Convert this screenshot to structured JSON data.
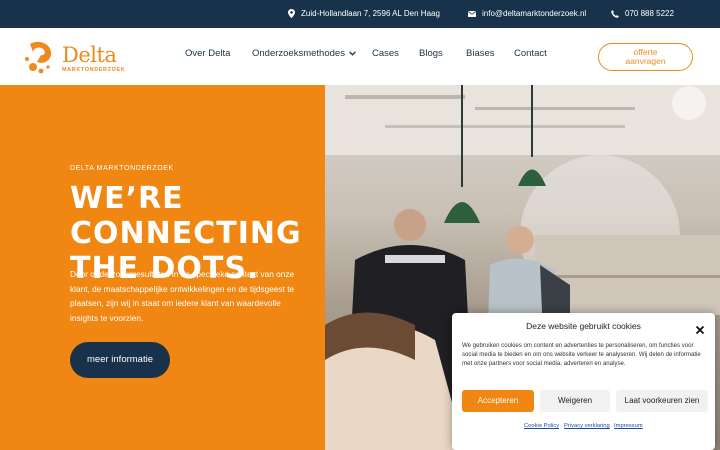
{
  "topbar": {
    "address": "Zuid-Hollandlaan 7, 2596 AL Den Haag",
    "email": "info@deltamarktonderzoek.nl",
    "phone": "070 888 5222"
  },
  "header": {
    "logo_word": "Delta",
    "logo_sub": "MARKTONDERZOEK",
    "nav": [
      "Over Delta",
      "Onderzoeksmethodes",
      "Cases",
      "Blogs",
      "Biases",
      "Contact"
    ],
    "cta_line1": "offerte",
    "cta_line2": "aanvragen"
  },
  "hero": {
    "eyebrow": "DELTA MARKTONDERZOEK",
    "headline_line1": "WE’RE CONNECTING",
    "headline_line2": "THE DOTS.",
    "intro": "Door onderzoeksresultaten in de specifieke context van onze klant, de maatschappelijke ontwikkelingen en de tijdsgeest te plaatsen, zijn wij in staat om iedere klant van waardevolle insights te voorzien.",
    "button": "meer informatie"
  },
  "cookie": {
    "title": "Deze website gebruikt cookies",
    "text": "We gebruiken cookies om content en advertenties te personaliseren, om functies voor social media te bieden en om ons website verkeer te analyseren. Wij delen de informatie met onze partners voor social media, adverteren en analyse.",
    "accept": "Accepteren",
    "deny": "Weigeren",
    "prefs": "Laat voorkeuren zien",
    "links": [
      "Cookie Policy",
      "Privacy verklaring",
      "Impressum"
    ]
  },
  "colors": {
    "navy": "#17324a",
    "orange": "#ef8712",
    "link": "#1a4b9b"
  },
  "icons": [
    "location-pin-icon",
    "mail-icon",
    "phone-icon",
    "chevron-down-icon",
    "close-icon"
  ]
}
